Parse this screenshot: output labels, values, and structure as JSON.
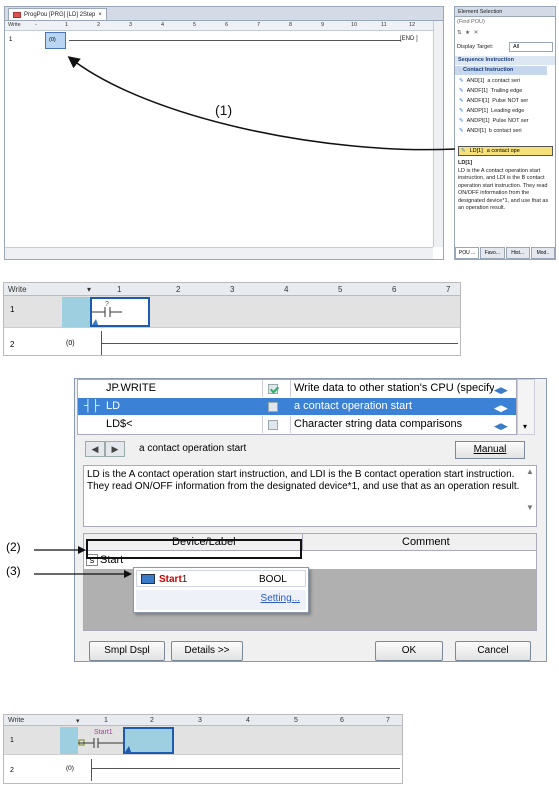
{
  "panel1": {
    "tab_title": "ProgPou [PRG] [LD] 2Step",
    "header": {
      "write": "Write",
      "cols": [
        "1",
        "2",
        "3",
        "4",
        "5",
        "6",
        "7",
        "8",
        "9",
        "10",
        "11",
        "12"
      ]
    },
    "row1_num": "1",
    "row1_zero": "(0)",
    "end_label": "[END ]",
    "side_title": "Element Selection",
    "find_placeholder": "(Find POU)",
    "display_target_label": "Display Target:",
    "display_target_value": "All",
    "seq_category": "Sequence Instruction",
    "contact_category": "Contact Instruction",
    "items": [
      {
        "name": "AND[1]",
        "desc": "a contact seri"
      },
      {
        "name": "ANDF[1]",
        "desc": "Trailing edge"
      },
      {
        "name": "ANDFI[1]",
        "desc": "Pulse NOT ser"
      },
      {
        "name": "ANDP[1]",
        "desc": "Leading edge"
      },
      {
        "name": "ANDPI[1]",
        "desc": "Pulse NOT ser"
      },
      {
        "name": "ANDI[1]",
        "desc": "b contact seri"
      }
    ],
    "selected_item": {
      "name": "LD[1]",
      "desc": "a contact ope"
    },
    "desc_title": "LD[1]",
    "desc_text": "LD is the A contact operation start instruction, and LDI is the B contact operation start instruction. They read ON/OFF information from the designated device*1, and use that as an operation result.",
    "bottom_tabs": [
      "POU ...",
      "Favo...",
      "Hist...",
      "Mod.."
    ],
    "callout": "(1)"
  },
  "panel2": {
    "header": {
      "write": "Write",
      "cols": [
        "1",
        "2",
        "3",
        "4",
        "5",
        "6",
        "7"
      ]
    },
    "row1_num": "1",
    "row2_num": "2",
    "row2_zero": "(0)",
    "contact_mark": "?"
  },
  "panel3": {
    "rows": [
      {
        "name": "JP.WRITE",
        "checked": true,
        "desc": "Write data to other station's CPU (specify own ne"
      },
      {
        "name": "LD",
        "checked": false,
        "desc": "a contact operation start"
      },
      {
        "name": "LD$<",
        "checked": false,
        "desc": "Character string data comparisons"
      }
    ],
    "nav_text": "a contact operation start",
    "manual_label": "Manual",
    "desc_text": "LD is the A contact operation start instruction, and LDI is the B contact operation start instruction. They read ON/OFF information from the designated device*1, and use that as an operation result.",
    "col_device": "Device/Label",
    "col_comment": "Comment",
    "s_icon": "s",
    "input_value": "Start",
    "popup_name_bold": "Start",
    "popup_name_rest": "1",
    "popup_type": "BOOL",
    "popup_setting": "Setting...",
    "btn_smpl": "Smpl Dspl",
    "btn_details": "Details >>",
    "btn_ok": "OK",
    "btn_cancel": "Cancel",
    "callout2": "(2)",
    "callout3": "(3)"
  },
  "panel4": {
    "header": {
      "write": "Write",
      "cols": [
        "1",
        "2",
        "3",
        "4",
        "5",
        "6",
        "7"
      ]
    },
    "row1_num": "1",
    "row2_num": "2",
    "row2_zero": "(0)",
    "contact_label": "Start1"
  },
  "colors": {
    "selection_blue": "#1d5bb0",
    "cell_blue": "#9ecfe0",
    "highlight_row": "#3b82d6",
    "popup_label_red": "#c00"
  }
}
